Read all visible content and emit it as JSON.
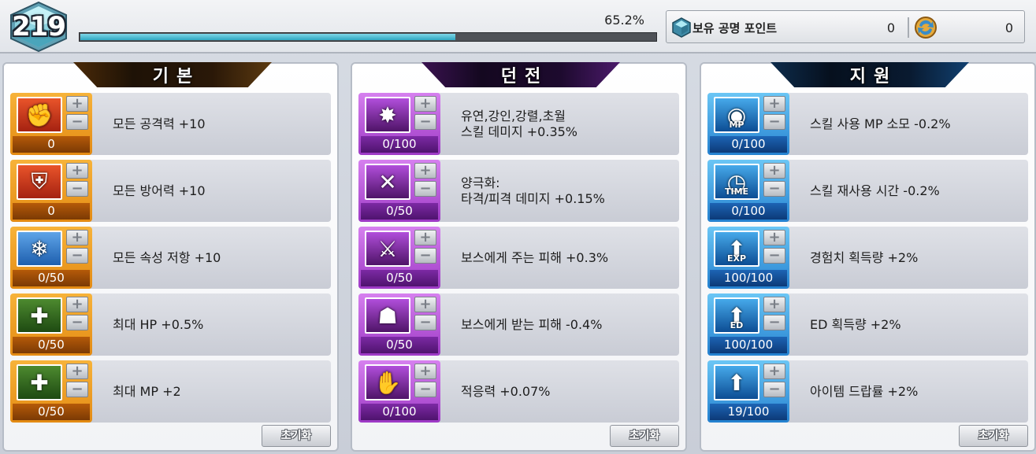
{
  "header": {
    "level": "219",
    "exp_percent": "65.2%",
    "exp_fill": 0.652,
    "points_label": "보유 공명 포인트",
    "points_value": "0",
    "coin_value": "0"
  },
  "panels": [
    {
      "title": "기본",
      "reset_label": "초기화",
      "rows": [
        {
          "icon": "attack-icon",
          "count": "0",
          "lines": [
            "모든 공격력 +10"
          ]
        },
        {
          "icon": "defense-icon",
          "count": "0",
          "lines": [
            "모든 방어력 +10"
          ]
        },
        {
          "icon": "element-resist-icon",
          "count": "0/50",
          "lines": [
            "모든 속성 저항 +10"
          ]
        },
        {
          "icon": "max-hp-icon",
          "count": "0/50",
          "lines": [
            "최대 HP +0.5%"
          ]
        },
        {
          "icon": "max-mp-icon",
          "count": "0/50",
          "lines": [
            "최대 MP +2"
          ]
        }
      ]
    },
    {
      "title": "던전",
      "reset_label": "초기화",
      "rows": [
        {
          "icon": "skill-damage-icon",
          "count": "0/100",
          "lines": [
            "유연,강인,강렬,초월",
            "스킬 데미지 +0.35%"
          ]
        },
        {
          "icon": "polarization-icon",
          "count": "0/50",
          "lines": [
            "양극화:",
            "타격/피격 데미지 +0.15%"
          ]
        },
        {
          "icon": "boss-damage-icon",
          "count": "0/50",
          "lines": [
            "보스에게 주는 피해 +0.3%"
          ]
        },
        {
          "icon": "boss-defense-icon",
          "count": "0/50",
          "lines": [
            "보스에게 받는 피해 -0.4%"
          ]
        },
        {
          "icon": "adaptability-icon",
          "count": "0/100",
          "lines": [
            "적응력 +0.07%"
          ]
        }
      ]
    },
    {
      "title": "지원",
      "reset_label": "초기화",
      "rows": [
        {
          "icon": "mp-cost-icon",
          "icon_caption": "MP",
          "count": "0/100",
          "lines": [
            "스킬 사용 MP 소모 -0.2%"
          ]
        },
        {
          "icon": "cooldown-icon",
          "icon_caption": "TIME",
          "count": "0/100",
          "lines": [
            "스킬 재사용 시간 -0.2%"
          ]
        },
        {
          "icon": "exp-gain-icon",
          "icon_caption": "EXP",
          "count": "100/100",
          "lines": [
            "경험치 획득량 +2%"
          ]
        },
        {
          "icon": "ed-gain-icon",
          "icon_caption": "ED",
          "count": "100/100",
          "lines": [
            "ED 획득량 +2%"
          ]
        },
        {
          "icon": "item-drop-icon",
          "count": "19/100",
          "lines": [
            "아이템 드랍률 +2%"
          ]
        }
      ]
    }
  ],
  "colors": {
    "basic_accent": "#e38a12",
    "dungeon_accent": "#9d39c5",
    "support_accent": "#2481d0",
    "exp_fill": "#2fa7c2"
  }
}
